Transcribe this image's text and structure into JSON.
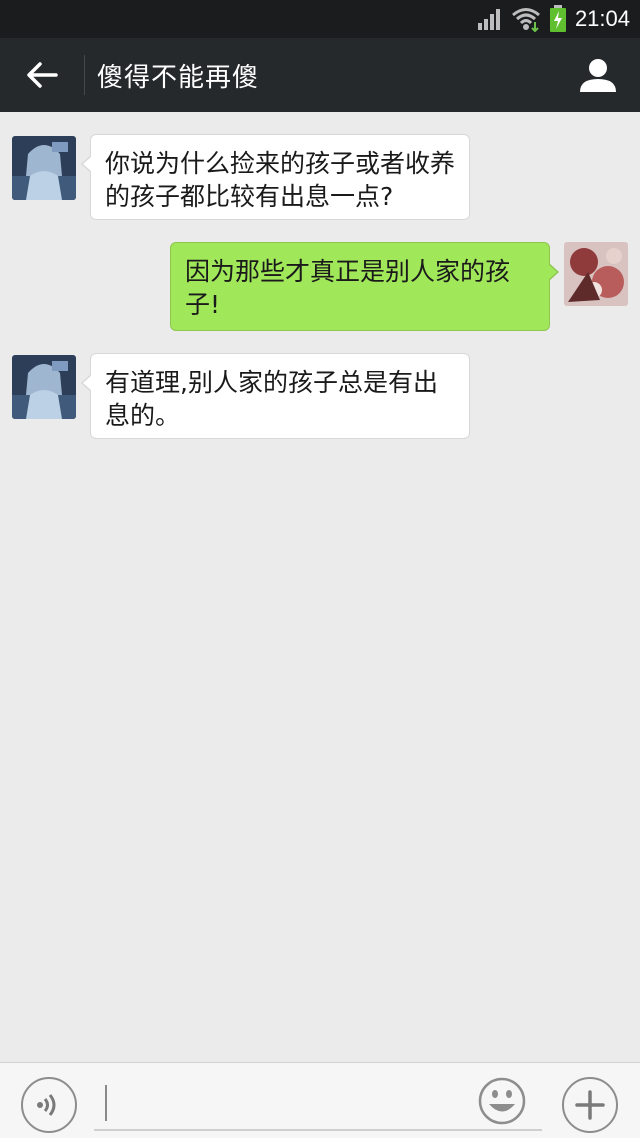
{
  "status_bar": {
    "time": "21:04",
    "icons": [
      "signal-icon",
      "wifi-icon",
      "battery-charging-icon"
    ]
  },
  "header": {
    "back_icon": "arrow-left-icon",
    "title": "傻得不能再傻",
    "profile_icon": "person-icon"
  },
  "messages": [
    {
      "side": "left",
      "text_line1": "你说为什么捡来的孩子或者收养",
      "text_line2": "的孩子都比较有出息一点?"
    },
    {
      "side": "right",
      "text_line1": "因为那些才真正是别人家的孩",
      "text_line2": "子!"
    },
    {
      "side": "left",
      "text_line1": "有道理,别人家的孩子总是有出",
      "text_line2": "息的。"
    }
  ],
  "input_bar": {
    "voice_icon": "voice-icon",
    "text_value": "",
    "emoji_icon": "smiley-icon",
    "plus_icon": "plus-icon"
  },
  "colors": {
    "status_bar_bg": "#1b1c1e",
    "title_bar_bg": "#26292c",
    "chat_bg": "#ebebeb",
    "bubble_left_bg": "#ffffff",
    "bubble_right_bg": "#a0e75a"
  }
}
